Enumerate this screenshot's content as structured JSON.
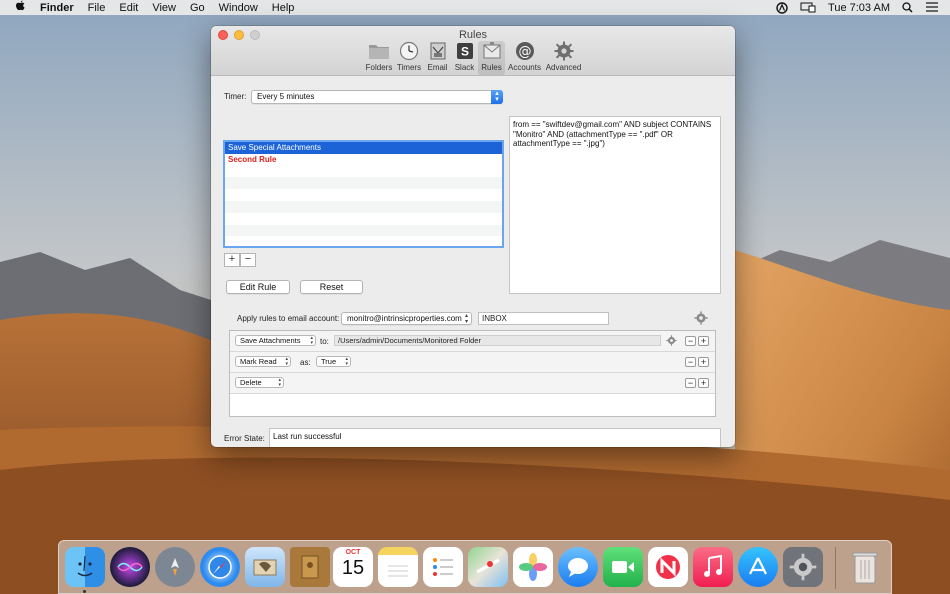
{
  "menubar": {
    "apple_icon": "apple-logo-icon",
    "app_name": "Finder",
    "items": [
      "File",
      "Edit",
      "View",
      "Go",
      "Window",
      "Help"
    ],
    "clock": "Tue 7:03 AM"
  },
  "window": {
    "title": "Rules",
    "toolbar": [
      {
        "label": "Folders",
        "icon": "folder-icon"
      },
      {
        "label": "Timers",
        "icon": "clock-icon"
      },
      {
        "label": "Email",
        "icon": "email-icon"
      },
      {
        "label": "Slack",
        "icon": "slack-icon"
      },
      {
        "label": "Rules",
        "icon": "rules-icon",
        "active": true
      },
      {
        "label": "Accounts",
        "icon": "at-icon"
      },
      {
        "label": "Advanced",
        "icon": "gear-icon"
      }
    ]
  },
  "rules_pane": {
    "timer_label": "Timer:",
    "timer_value": "Every 5 minutes",
    "rules": [
      {
        "name": "Save Special Attachments",
        "selected": true
      },
      {
        "name": "Second Rule",
        "selected": false
      }
    ],
    "add_label": "+",
    "remove_label": "−",
    "edit_rule_label": "Edit Rule",
    "reset_label": "Reset",
    "predicate": "from == \"swiftdev@gmail.com\" AND subject CONTAINS \"Monitro\" AND (attachmentType == \".pdf\" OR attachmentType == \".jpg\")",
    "apply_label": "Apply rules to email account:",
    "account_value": "monitro@intrinsicproperties.com",
    "mailbox_value": "INBOX",
    "actions": [
      {
        "action": "Save Attachments",
        "connector": "to:",
        "value": "/Users/admin/Documents/Monitored Folder"
      },
      {
        "action": "Mark Read",
        "connector": "as:",
        "value": "True"
      },
      {
        "action": "Delete",
        "connector": "",
        "value": ""
      }
    ],
    "minus_label": "−",
    "plus_label": "+",
    "error_label": "Error State:",
    "error_value": "Last run successful"
  },
  "dock": {
    "apps": [
      "Finder",
      "Siri",
      "Launchpad",
      "Safari",
      "Mail",
      "Contacts",
      "Calendar",
      "Notes",
      "Reminders",
      "Maps",
      "Photos",
      "Messages",
      "FaceTime",
      "News",
      "Music",
      "App Store",
      "System Preferences",
      "Trash"
    ],
    "calendar_month": "OCT",
    "calendar_day": "15"
  }
}
